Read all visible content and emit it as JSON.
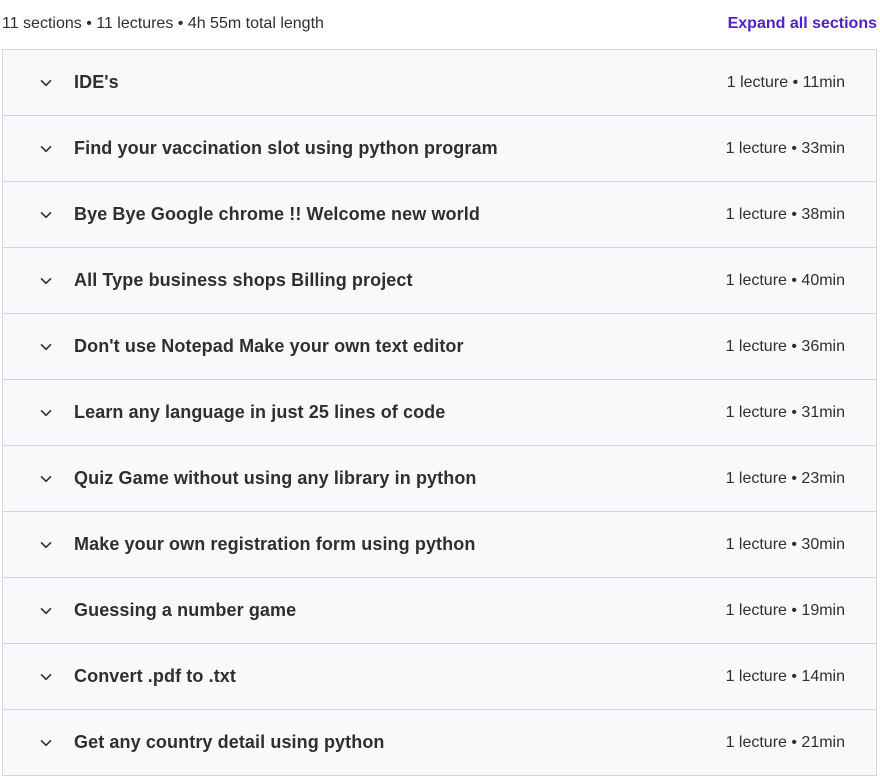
{
  "summary": {
    "text": "11 sections • 11 lectures • 4h 55m total length",
    "expand_label": "Expand all sections"
  },
  "icons": {
    "section_toggle": "chevron-down-icon"
  },
  "colors": {
    "link": "#5022c3",
    "section_bg": "#f7f9fa",
    "border": "#d1d7dc",
    "text": "#2d2f31"
  },
  "sections": [
    {
      "title": "IDE's",
      "meta": "1 lecture • 11min"
    },
    {
      "title": "Find your vaccination slot using python program",
      "meta": "1 lecture • 33min"
    },
    {
      "title": "Bye Bye Google chrome !! Welcome new world",
      "meta": "1 lecture • 38min"
    },
    {
      "title": "All Type business shops Billing project",
      "meta": "1 lecture • 40min"
    },
    {
      "title": "Don't use Notepad Make your own text editor",
      "meta": "1 lecture • 36min"
    },
    {
      "title": "Learn any language in just 25 lines of code",
      "meta": "1 lecture • 31min"
    },
    {
      "title": "Quiz Game without using any library in python",
      "meta": "1 lecture • 23min"
    },
    {
      "title": "Make your own registration form using python",
      "meta": "1 lecture • 30min"
    },
    {
      "title": "Guessing a number game",
      "meta": "1 lecture • 19min"
    },
    {
      "title": "Convert .pdf to .txt",
      "meta": "1 lecture • 14min"
    },
    {
      "title": "Get any country detail using python",
      "meta": "1 lecture • 21min"
    }
  ]
}
